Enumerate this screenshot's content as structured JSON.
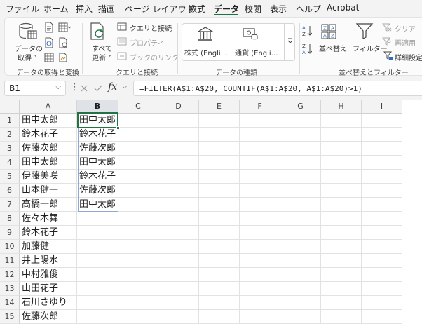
{
  "menu": {
    "tabs": [
      "ファイル",
      "ホーム",
      "挿入",
      "描画",
      "ページ レイアウト",
      "数式",
      "データ",
      "校閲",
      "表示",
      "ヘルプ",
      "Acrobat"
    ],
    "active_tab": "データ"
  },
  "ribbon": {
    "get_data_label_1": "データの",
    "get_data_label_2": "取得 ˅",
    "group_get": "データの取得と変換",
    "refresh_all_1": "すべて",
    "refresh_all_2": "更新 ˅",
    "queries_connections": "クエリと接続",
    "properties": "プロパティ",
    "edit_links": "ブックのリンク",
    "group_queries": "クエリと接続",
    "stocks": "株式 (Engli…",
    "currencies": "通貨 (Engli…",
    "group_types": "データの種類",
    "sort": "並べ替え",
    "filter": "フィルター",
    "clear": "クリア",
    "reapply": "再適用",
    "advanced": "詳細設定",
    "group_sort": "並べ替えとフィルター"
  },
  "formula_bar": {
    "name_box": "B1",
    "formula": "=FILTER(A$1:A$20, COUNTIF(A$1:A$20, A$1:A$20)>1)"
  },
  "sheet": {
    "columns": [
      "A",
      "B",
      "C",
      "D",
      "E",
      "F",
      "G",
      "H",
      "I"
    ],
    "rows": [
      "1",
      "2",
      "3",
      "4",
      "5",
      "6",
      "7",
      "8",
      "9",
      "10",
      "11",
      "12",
      "13",
      "14",
      "15"
    ],
    "col_a": [
      "田中太郎",
      "鈴木花子",
      "佐藤次郎",
      "田中太郎",
      "伊藤美咲",
      "山本健一",
      "高橋一郎",
      "佐々木舞",
      "鈴木花子",
      "加藤健",
      "井上陽水",
      "中村雅俊",
      "山田花子",
      "石川さゆり",
      "佐藤次郎"
    ],
    "col_b": [
      "田中太郎",
      "鈴木花子",
      "佐藤次郎",
      "田中太郎",
      "鈴木花子",
      "佐藤次郎",
      "田中太郎",
      "",
      "",
      "",
      "",
      "",
      "",
      "",
      ""
    ]
  }
}
